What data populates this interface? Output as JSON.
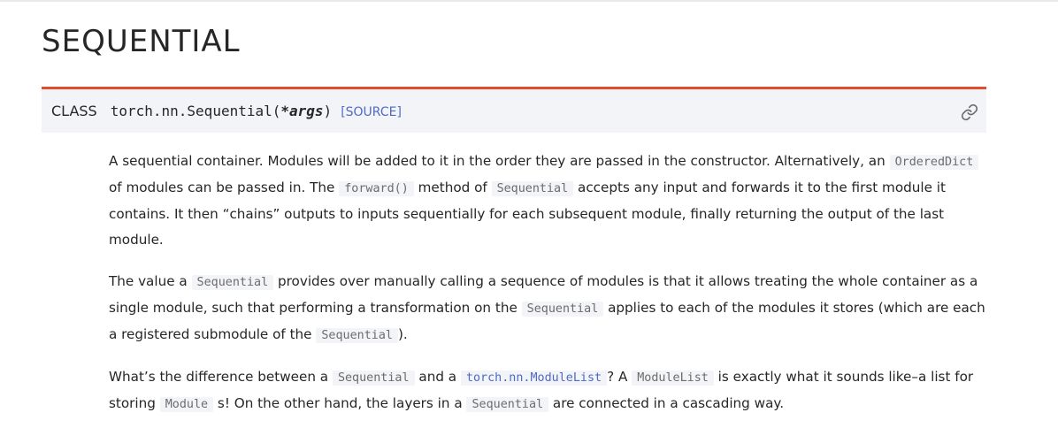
{
  "title": "SEQUENTIAL",
  "signature": {
    "class_label": "CLASS",
    "name": "torch.nn.Sequential(",
    "args": "*args",
    "close": ")",
    "source_link": "[SOURCE]"
  },
  "icons": {
    "permalink": "link-icon"
  },
  "colors": {
    "accent": "#e44c2c",
    "link": "#4e6ac7",
    "signature_bg": "#f3f4f7"
  },
  "paragraphs": {
    "p1": {
      "t1": "A sequential container. Modules will be added to it in the order they are passed in the constructor. Alternatively, an ",
      "c1": "OrderedDict",
      "t2": " of modules can be passed in. The ",
      "c2": "forward()",
      "t3": " method of ",
      "c3": "Sequential",
      "t4": " accepts any input and forwards it to the first module it contains. It then “chains” outputs to inputs sequentially for each subsequent module, finally returning the output of the last module."
    },
    "p2": {
      "t1": "The value a ",
      "c1": "Sequential",
      "t2": " provides over manually calling a sequence of modules is that it allows treating the whole container as a single module, such that performing a transformation on the ",
      "c2": "Sequential",
      "t3": " applies to each of the modules it stores (which are each a registered submodule of the ",
      "c3": "Sequential",
      "t4": ")."
    },
    "p3": {
      "t1": "What’s the difference between a ",
      "c1": "Sequential",
      "t2": " and a ",
      "link1": "torch.nn.ModuleList",
      "t3": "? A ",
      "c2": "ModuleList",
      "t4": " is exactly what it sounds like–a list for storing ",
      "c3": "Module",
      "t5": " s! On the other hand, the layers in a ",
      "c4": "Sequential",
      "t6": " are connected in a cascading way."
    }
  }
}
